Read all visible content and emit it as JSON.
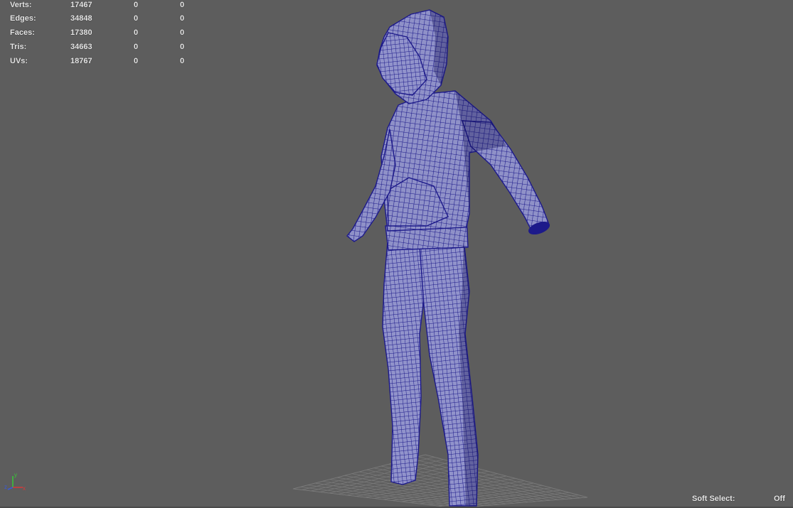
{
  "hud": {
    "rows": [
      {
        "label": "Verts:",
        "v1": "17467",
        "v2": "0",
        "v3": "0"
      },
      {
        "label": "Edges:",
        "v1": "34848",
        "v2": "0",
        "v3": "0"
      },
      {
        "label": "Faces:",
        "v1": "17380",
        "v2": "0",
        "v3": "0"
      },
      {
        "label": "Tris:",
        "v1": "34663",
        "v2": "0",
        "v3": "0"
      },
      {
        "label": "UVs:",
        "v1": "18767",
        "v2": "0",
        "v3": "0"
      }
    ]
  },
  "soft_select": {
    "label": "Soft Select:",
    "value": "Off"
  },
  "axis_indicator": {
    "y_label": "y",
    "x_label": "x",
    "z_label": "z"
  },
  "colors": {
    "viewport_bg": "#5d5d5d",
    "mesh_fill": "#8f91c8",
    "wire": "#1d1a8a",
    "grid": "#7a7a7a"
  }
}
